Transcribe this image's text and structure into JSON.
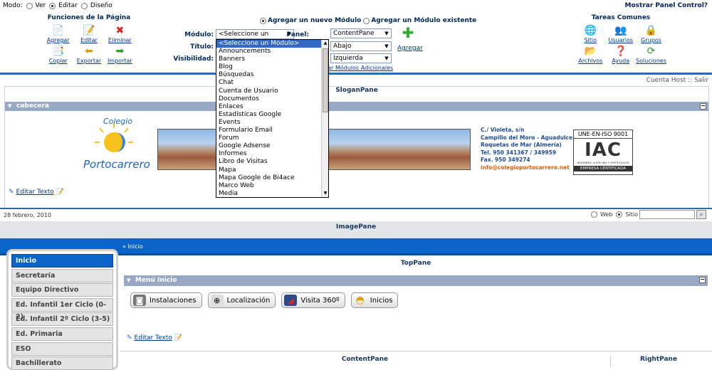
{
  "controlpanel": {
    "mode_label": "Modo:",
    "modes": [
      {
        "label": "Ver",
        "selected": false
      },
      {
        "label": "Editar",
        "selected": true
      },
      {
        "label": "Diseño",
        "selected": false
      }
    ],
    "show_panel": "Mostrar Panel Control?",
    "functions_title": "Funciones de la Página",
    "functions": [
      {
        "label": "Agregar",
        "icon": "add-page-icon"
      },
      {
        "label": "Editar",
        "icon": "edit-page-icon"
      },
      {
        "label": "Eliminar",
        "icon": "delete-page-icon"
      },
      {
        "label": "Copiar",
        "icon": "copy-page-icon"
      },
      {
        "label": "Exportar",
        "icon": "export-page-icon"
      },
      {
        "label": "Importar",
        "icon": "import-page-icon"
      }
    ],
    "add_new_module": "Agregar un nuevo Módulo",
    "add_existing_module": "Agregar un Módulo existente",
    "module_label": "Módulo:",
    "module_value": "<Seleccione un Módulo>",
    "title_label": "Título:",
    "visibility_label": "Visibilidad:",
    "pane_label": "Panel:",
    "pane_value": "ContentPane",
    "position_value": "Abajo",
    "align_value": "Izquierda",
    "add_link": "Agregar",
    "install_link": "lar Módulos Adicionales",
    "tasks_title": "Tareas Comunes",
    "tasks": [
      {
        "label": "Sitio",
        "icon": "globe-icon"
      },
      {
        "label": "Usuarios",
        "icon": "users-icon"
      },
      {
        "label": "Grupos",
        "icon": "lock-icon"
      },
      {
        "label": "Archivos",
        "icon": "folder-icon"
      },
      {
        "label": "Ayuda",
        "icon": "help-icon"
      },
      {
        "label": "Soluciones",
        "icon": "solutions-icon"
      }
    ]
  },
  "module_dropdown": {
    "options": [
      "<Seleccione un Módulo>",
      "Announcements",
      "Banners",
      "Blog",
      "Búsquedas",
      "Chat",
      "Cuenta de Usuario",
      "Documentos",
      "Enlaces",
      "Estadísticas Google",
      "Events",
      "Formulario Email",
      "Forum",
      "Google Adsense",
      "Informes",
      "Libro de Visitas",
      "Mapa",
      "Mapa Google de Bi4ace",
      "Marco Web",
      "Media"
    ]
  },
  "hostbar": {
    "text": "Cuenta Host :: Salir"
  },
  "slogan": {
    "pane_title": "SloganPane",
    "module_title": "cabecera",
    "logo_top": "Colegio",
    "logo_bottom": "Portocarrero",
    "address": [
      "C./ Violeta, s/n",
      "Campillo del Moro - Aguadulce",
      "Roquetas de Mar (Almería)",
      "Tel. 950  341367 / 349959",
      "Fax. 950 349274"
    ],
    "email": "info@colegioportocarrero.net",
    "cert_top": "UNE-EN-ISO 9001",
    "cert_logo": "IAC",
    "cert_small": "INGENIERÍA, AUDITORÍA Y CERTIFICACIÓN",
    "cert_bottom": "EMPRESA CERTIFICADA",
    "edit_text": "Editar Texto"
  },
  "datebar": {
    "date": "28 febrero, 2010",
    "web_label": "Web",
    "site_label": "Sitio"
  },
  "imagepane": {
    "title": "ImagePane"
  },
  "breadcrumb": {
    "text": "» Inicio"
  },
  "leftnav": {
    "items": [
      "Inicio",
      "Secretaría",
      "Equipo Directivo",
      "Ed. Infantil 1er Ciclo (0-2)",
      "Ed. Infantil 2º Ciclo (3-5)",
      "Ed. Primaria",
      "ESO",
      "Bachillerato"
    ]
  },
  "toppane": {
    "title": "TopPane",
    "module_title": "Menú Inicio",
    "buttons": [
      {
        "label": "Instalaciones",
        "icon": "camera-icon"
      },
      {
        "label": "Localización",
        "icon": "compass-icon"
      },
      {
        "label": "Visita 360º",
        "icon": "panorama-icon"
      },
      {
        "label": "Inicios",
        "icon": "helmet-icon"
      }
    ],
    "edit_text": "Editar Texto"
  },
  "panes": {
    "content": "ContentPane",
    "right": "RightPane"
  }
}
